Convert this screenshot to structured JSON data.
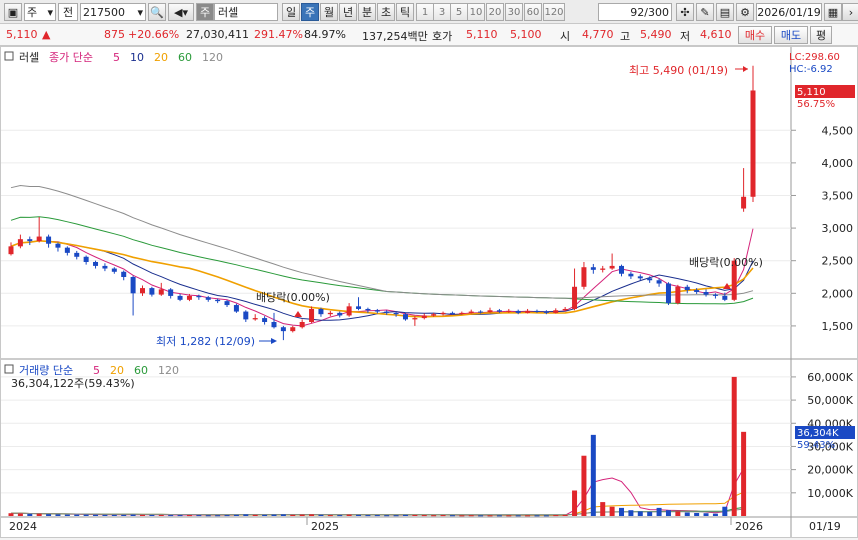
{
  "toolbar": {
    "market": "주",
    "type": "전",
    "code": "217500",
    "search_mark": "주",
    "name": "러셀",
    "periods": [
      "일",
      "주",
      "월",
      "년",
      "분",
      "초",
      "틱"
    ],
    "active_period": "주",
    "intervals": [
      "1",
      "3",
      "5",
      "10",
      "20",
      "30",
      "60",
      "120"
    ],
    "count": "92",
    "count_total": "/300",
    "date": "2026/01/19"
  },
  "quote": {
    "price": "5,110",
    "up_arrow": "▲",
    "change": "875",
    "change_pct": "+20.66%",
    "volume": "27,030,411",
    "vol_ratio": "291.47%",
    "turnover": "84.97%",
    "amount": "137,254백만",
    "hoga_label": "호가",
    "ask": "5,110",
    "bid": "5,100",
    "open_label": "시",
    "open": "4,770",
    "high_label": "고",
    "high": "5,490",
    "low_label": "저",
    "low": "4,610",
    "buy_button": "매수",
    "sell_button": "매도",
    "eval_button": "평"
  },
  "price_panel": {
    "title": "러셀",
    "legend_title": "종가 단순",
    "ma": [
      {
        "label": "5",
        "color": "#d4237a"
      },
      {
        "label": "10",
        "color": "#1a2f8f"
      },
      {
        "label": "20",
        "color": "#f0a000"
      },
      {
        "label": "60",
        "color": "#2a9a3a"
      },
      {
        "label": "120",
        "color": "#8c8c8c"
      }
    ],
    "lc": "LC:298.60",
    "hc": "HC:-6.92",
    "last_price_tag": "5,110",
    "last_pct_tag": "56.75%",
    "high_note": "최고 5,490 (01/19)",
    "low_note": "최저 1,282 (12/09)",
    "div1": "배당락(0.00%)",
    "div2": "배당락(0.00%)"
  },
  "volume_panel": {
    "title": "거래량 단순",
    "ma": [
      {
        "label": "5",
        "color": "#d4237a"
      },
      {
        "label": "20",
        "color": "#f0a000"
      },
      {
        "label": "60",
        "color": "#2a9a3a"
      },
      {
        "label": "120",
        "color": "#8c8c8c"
      }
    ],
    "current": "36,304,122주(59.43%)",
    "tag_value": "36,304K",
    "tag_pct": "59.43%"
  },
  "x_axis": {
    "labels": [
      "2024",
      "2025",
      "2026"
    ],
    "last_date": "01/19"
  },
  "chart_data": {
    "type": "candlestick",
    "price_axis": {
      "ticks": [
        1500,
        2000,
        2500,
        3000,
        3500,
        4000,
        4500
      ],
      "range": [
        1100,
        5700
      ]
    },
    "volume_axis": {
      "ticks": [
        "10,000K",
        "20,000K",
        "30,000K",
        "40,000K",
        "50,000K",
        "60,000K"
      ],
      "range": [
        0,
        66000
      ]
    },
    "candles": [
      {
        "o": 2600,
        "c": 2720,
        "h": 2780,
        "l": 2580
      },
      {
        "o": 2720,
        "c": 2830,
        "h": 2900,
        "l": 2690
      },
      {
        "o": 2830,
        "c": 2800,
        "h": 2870,
        "l": 2740
      },
      {
        "o": 2800,
        "c": 2870,
        "h": 3170,
        "l": 2780
      },
      {
        "o": 2870,
        "c": 2760,
        "h": 2900,
        "l": 2700
      },
      {
        "o": 2760,
        "c": 2700,
        "h": 2780,
        "l": 2640
      },
      {
        "o": 2700,
        "c": 2620,
        "h": 2720,
        "l": 2580
      },
      {
        "o": 2620,
        "c": 2560,
        "h": 2650,
        "l": 2520
      },
      {
        "o": 2560,
        "c": 2480,
        "h": 2580,
        "l": 2440
      },
      {
        "o": 2480,
        "c": 2420,
        "h": 2500,
        "l": 2380
      },
      {
        "o": 2420,
        "c": 2380,
        "h": 2460,
        "l": 2340
      },
      {
        "o": 2380,
        "c": 2330,
        "h": 2400,
        "l": 2300
      },
      {
        "o": 2330,
        "c": 2250,
        "h": 2350,
        "l": 2200
      },
      {
        "o": 2250,
        "c": 2000,
        "h": 2270,
        "l": 1660
      },
      {
        "o": 2000,
        "c": 2080,
        "h": 2120,
        "l": 1960
      },
      {
        "o": 2080,
        "c": 1980,
        "h": 2100,
        "l": 1950
      },
      {
        "o": 1980,
        "c": 2060,
        "h": 2160,
        "l": 1960
      },
      {
        "o": 2060,
        "c": 1960,
        "h": 2080,
        "l": 1920
      },
      {
        "o": 1960,
        "c": 1900,
        "h": 1990,
        "l": 1880
      },
      {
        "o": 1900,
        "c": 1960,
        "h": 1990,
        "l": 1880
      },
      {
        "o": 1960,
        "c": 1940,
        "h": 1980,
        "l": 1900
      },
      {
        "o": 1940,
        "c": 1900,
        "h": 1960,
        "l": 1870
      },
      {
        "o": 1900,
        "c": 1880,
        "h": 1920,
        "l": 1850
      },
      {
        "o": 1880,
        "c": 1820,
        "h": 1900,
        "l": 1790
      },
      {
        "o": 1820,
        "c": 1720,
        "h": 1840,
        "l": 1700
      },
      {
        "o": 1720,
        "c": 1600,
        "h": 1740,
        "l": 1560
      },
      {
        "o": 1600,
        "c": 1620,
        "h": 1680,
        "l": 1580
      },
      {
        "o": 1620,
        "c": 1560,
        "h": 1650,
        "l": 1520
      },
      {
        "o": 1560,
        "c": 1480,
        "h": 1700,
        "l": 1460
      },
      {
        "o": 1480,
        "c": 1420,
        "h": 1500,
        "l": 1282
      },
      {
        "o": 1420,
        "c": 1480,
        "h": 1500,
        "l": 1400
      },
      {
        "o": 1480,
        "c": 1560,
        "h": 1600,
        "l": 1460
      },
      {
        "o": 1560,
        "c": 1760,
        "h": 1800,
        "l": 1540
      },
      {
        "o": 1760,
        "c": 1680,
        "h": 1780,
        "l": 1640
      },
      {
        "o": 1680,
        "c": 1700,
        "h": 1730,
        "l": 1650
      },
      {
        "o": 1700,
        "c": 1660,
        "h": 1720,
        "l": 1630
      },
      {
        "o": 1660,
        "c": 1800,
        "h": 1850,
        "l": 1640
      },
      {
        "o": 1800,
        "c": 1760,
        "h": 1940,
        "l": 1740
      },
      {
        "o": 1760,
        "c": 1740,
        "h": 1780,
        "l": 1700
      },
      {
        "o": 1740,
        "c": 1720,
        "h": 1760,
        "l": 1690
      },
      {
        "o": 1720,
        "c": 1700,
        "h": 1740,
        "l": 1670
      },
      {
        "o": 1700,
        "c": 1680,
        "h": 1720,
        "l": 1640
      },
      {
        "o": 1680,
        "c": 1600,
        "h": 1700,
        "l": 1580
      },
      {
        "o": 1600,
        "c": 1620,
        "h": 1650,
        "l": 1500
      },
      {
        "o": 1620,
        "c": 1660,
        "h": 1690,
        "l": 1600
      },
      {
        "o": 1660,
        "c": 1680,
        "h": 1700,
        "l": 1640
      },
      {
        "o": 1680,
        "c": 1700,
        "h": 1720,
        "l": 1660
      },
      {
        "o": 1700,
        "c": 1690,
        "h": 1720,
        "l": 1670
      },
      {
        "o": 1690,
        "c": 1700,
        "h": 1720,
        "l": 1670
      },
      {
        "o": 1700,
        "c": 1720,
        "h": 1750,
        "l": 1690
      },
      {
        "o": 1720,
        "c": 1710,
        "h": 1740,
        "l": 1690
      },
      {
        "o": 1710,
        "c": 1740,
        "h": 1780,
        "l": 1700
      },
      {
        "o": 1740,
        "c": 1720,
        "h": 1760,
        "l": 1700
      },
      {
        "o": 1720,
        "c": 1730,
        "h": 1760,
        "l": 1700
      },
      {
        "o": 1730,
        "c": 1700,
        "h": 1750,
        "l": 1680
      },
      {
        "o": 1700,
        "c": 1730,
        "h": 1760,
        "l": 1690
      },
      {
        "o": 1730,
        "c": 1720,
        "h": 1750,
        "l": 1700
      },
      {
        "o": 1720,
        "c": 1700,
        "h": 1740,
        "l": 1680
      },
      {
        "o": 1700,
        "c": 1740,
        "h": 1770,
        "l": 1690
      },
      {
        "o": 1740,
        "c": 1760,
        "h": 1790,
        "l": 1720
      },
      {
        "o": 1760,
        "c": 2100,
        "h": 2380,
        "l": 1740
      },
      {
        "o": 2100,
        "c": 2400,
        "h": 2480,
        "l": 2060
      },
      {
        "o": 2400,
        "c": 2360,
        "h": 2450,
        "l": 2300
      },
      {
        "o": 2360,
        "c": 2380,
        "h": 2420,
        "l": 2320
      },
      {
        "o": 2380,
        "c": 2420,
        "h": 2610,
        "l": 2360
      },
      {
        "o": 2420,
        "c": 2300,
        "h": 2440,
        "l": 2260
      },
      {
        "o": 2300,
        "c": 2260,
        "h": 2330,
        "l": 2220
      },
      {
        "o": 2260,
        "c": 2230,
        "h": 2290,
        "l": 2200
      },
      {
        "o": 2230,
        "c": 2200,
        "h": 2260,
        "l": 2160
      },
      {
        "o": 2200,
        "c": 2150,
        "h": 2230,
        "l": 2100
      },
      {
        "o": 2150,
        "c": 1850,
        "h": 2170,
        "l": 1820
      },
      {
        "o": 1850,
        "c": 2100,
        "h": 2130,
        "l": 1830
      },
      {
        "o": 2100,
        "c": 2050,
        "h": 2130,
        "l": 2000
      },
      {
        "o": 2050,
        "c": 2020,
        "h": 2080,
        "l": 1990
      },
      {
        "o": 2020,
        "c": 1980,
        "h": 2060,
        "l": 1950
      },
      {
        "o": 1980,
        "c": 1960,
        "h": 2000,
        "l": 1920
      },
      {
        "o": 1960,
        "c": 1900,
        "h": 2010,
        "l": 1880
      },
      {
        "o": 1900,
        "c": 2500,
        "h": 2540,
        "l": 1880
      },
      {
        "o": 3300,
        "c": 3480,
        "h": 3920,
        "l": 3250
      },
      {
        "o": 3480,
        "c": 5110,
        "h": 5490,
        "l": 3400
      }
    ],
    "volumes": [
      1200,
      1100,
      900,
      1000,
      800,
      700,
      600,
      600,
      600,
      550,
      500,
      500,
      500,
      600,
      500,
      450,
      450,
      400,
      400,
      400,
      400,
      350,
      350,
      400,
      500,
      700,
      500,
      500,
      600,
      700,
      500,
      600,
      700,
      500,
      400,
      400,
      600,
      500,
      400,
      400,
      350,
      350,
      500,
      450,
      400,
      350,
      400,
      350,
      300,
      350,
      300,
      300,
      300,
      300,
      300,
      300,
      300,
      300,
      400,
      500,
      11000,
      26000,
      35000,
      6000,
      4000,
      3500,
      2500,
      2000,
      1800,
      3500,
      2500,
      2000,
      1500,
      1300,
      1200,
      1000,
      4000,
      60000,
      36304
    ]
  }
}
